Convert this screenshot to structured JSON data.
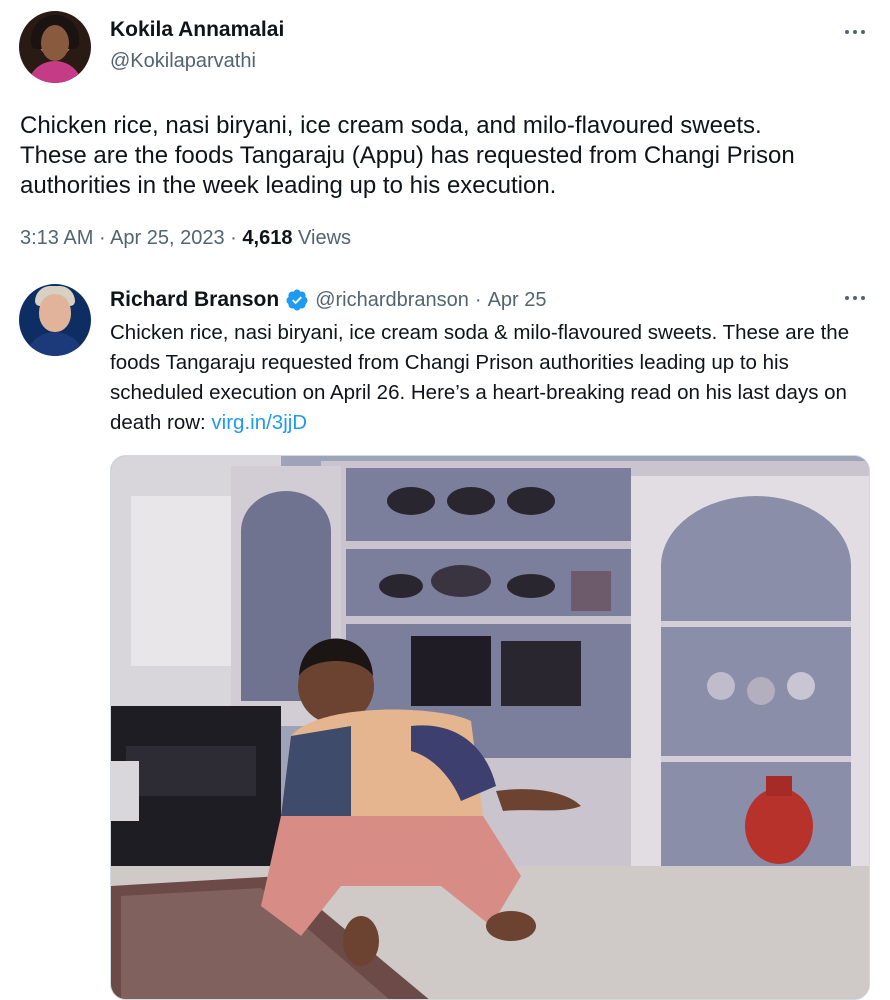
{
  "main_tweet": {
    "display_name": "Kokila Annamalai",
    "handle": "@Kokilaparvathi",
    "text": "Chicken rice, nasi biryani, ice cream soda, and milo-flavoured sweets.\nThese are the foods Tangaraju (Appu) has requested from Changi Prison\nauthorities in the week leading up to his execution.",
    "time": "3:13 AM",
    "date": "Apr 25, 2023",
    "views_count": "4,618",
    "views_label": "Views",
    "separator": "·"
  },
  "quoted_tweet": {
    "display_name": "Richard Branson",
    "handle": "@richardbranson",
    "separator": "·",
    "date": "Apr 25",
    "text_before_link": "Chicken rice, nasi biryani, ice cream soda & milo-flavoured sweets. These are the foods Tangaraju requested from Changi Prison authorities leading up to his scheduled execution on April 26. Here’s a heart-breaking read on his last days on death row: ",
    "link_text": "virg.in/3jjD"
  },
  "colors": {
    "text_primary": "#0f1419",
    "text_secondary": "#536471",
    "link": "#1d9bf0",
    "verified": "#1d9bf0"
  },
  "icons": {
    "more": "more-horizontal-icon",
    "verified": "verified-badge-icon"
  }
}
